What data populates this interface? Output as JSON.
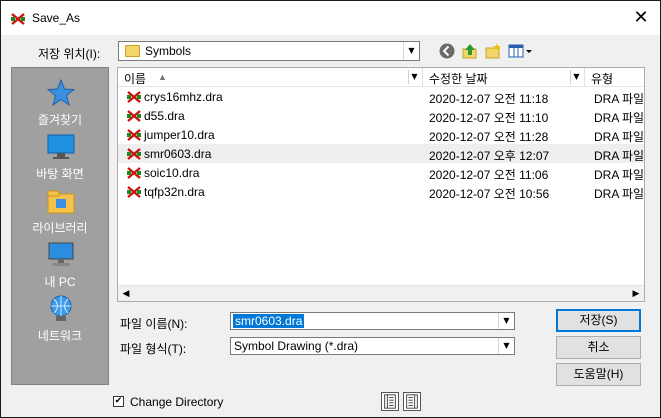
{
  "window": {
    "title": "Save_As",
    "close_glyph": "✕",
    "title_icon": "symbol-cross-icon"
  },
  "location": {
    "label": "저장 위치(I):",
    "value": "Symbols",
    "arrow": "▼"
  },
  "toolbar": {
    "icons": [
      "back-icon",
      "up-folder-icon",
      "new-folder-icon",
      "view-menu-icon"
    ]
  },
  "places": [
    {
      "label": "즐겨찾기",
      "icon": "star-icon"
    },
    {
      "label": "바탕 화면",
      "icon": "desktop-icon"
    },
    {
      "label": "라이브러리",
      "icon": "library-icon"
    },
    {
      "label": "내 PC",
      "icon": "computer-icon"
    },
    {
      "label": "네트워크",
      "icon": "network-icon"
    }
  ],
  "columns": [
    {
      "label": "이름",
      "sort": "▲",
      "dd": "▼"
    },
    {
      "label": "수정한 날짜",
      "dd": "▼"
    },
    {
      "label": "유형"
    }
  ],
  "files": [
    {
      "name": "crys16mhz.dra",
      "date": "2020-12-07 오전 11:18",
      "type": "DRA 파일"
    },
    {
      "name": "d55.dra",
      "date": "2020-12-07 오전 11:10",
      "type": "DRA 파일"
    },
    {
      "name": "jumper10.dra",
      "date": "2020-12-07 오전 11:28",
      "type": "DRA 파일"
    },
    {
      "name": "smr0603.dra",
      "date": "2020-12-07 오후 12:07",
      "type": "DRA 파일"
    },
    {
      "name": "soic10.dra",
      "date": "2020-12-07 오전 11:06",
      "type": "DRA 파일"
    },
    {
      "name": "tqfp32n.dra",
      "date": "2020-12-07 오전 10:56",
      "type": "DRA 파일"
    }
  ],
  "scroll": {
    "left": "◀",
    "right": "▶"
  },
  "filename": {
    "label": "파일 이름(N):",
    "value": "smr0603.dra",
    "arrow": "▼"
  },
  "filetype": {
    "label": "파일 형식(T):",
    "value": "Symbol Drawing (*.dra)",
    "arrow": "▼"
  },
  "buttons": {
    "save": "저장(S)",
    "cancel": "취소",
    "help": "도움말(H)"
  },
  "change_dir": {
    "label": "Change Directory",
    "checked": "✔"
  },
  "colors": {
    "selection": "#0078d7",
    "places_bg": "#a0a0a0"
  }
}
